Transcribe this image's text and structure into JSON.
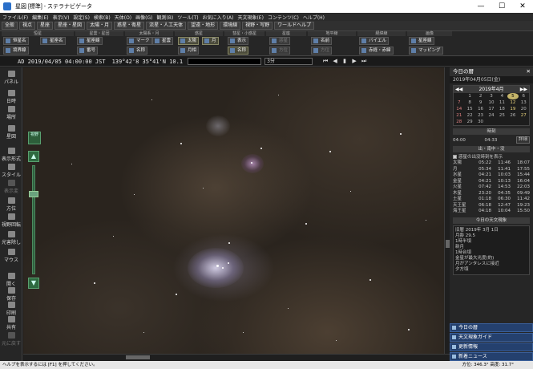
{
  "window": {
    "title": "星図 [標準] - ステラナビゲータ",
    "minimize": "—",
    "maximize": "☐",
    "close": "✕"
  },
  "menu": [
    "ファイル(F)",
    "編集(E)",
    "表示(V)",
    "設定(S)",
    "検索(B)",
    "天体(O)",
    "画像(G)",
    "観測(B)",
    "ツール(T)",
    "お気に入り(A)",
    "天文現象(E)",
    "コンテンツ(C)",
    "ヘルプ(H)"
  ],
  "toolbar": [
    "全般",
    "視点",
    "星座",
    "星座・星図",
    "太陽・月",
    "惑星・衛星",
    "流星・人工天体",
    "望遠・地形",
    "環境線",
    "視野・写野",
    "ワールドヘルプ"
  ],
  "ribbon": {
    "groups": [
      "恒星",
      "星雲・星団",
      "太陽系・月",
      "惑星",
      "彗星・小惑星",
      "星座",
      "地平線",
      "経緯線",
      "画像"
    ],
    "buttons": [
      "恒星名",
      "星座名",
      "星座線",
      "マーク",
      "星雲",
      "太陽",
      "月",
      "表示",
      "惑星",
      "名前",
      "バイエル",
      "星座線",
      "境界線",
      "番号",
      "名称",
      "月相",
      "名称",
      "方位",
      "方位",
      "赤道・経緯",
      "赤経・赤緯",
      "投影",
      "マッピング"
    ]
  },
  "infobar": {
    "datetime": "AD 2019/04/05 04:00:00 JST",
    "coords": "139°42'8  35°41'N  10.1",
    "combo": "3分"
  },
  "left_sidebar": [
    "パネル",
    "日時",
    "場所",
    "星図",
    "表示形式",
    "スタイル",
    "表示変",
    "方位",
    "視野回転",
    "光害除し",
    "マウス",
    "開く",
    "保存",
    "印刷",
    "共有",
    "元に戻す"
  ],
  "sky": {
    "fov_label": "視野"
  },
  "right_panel": {
    "header": "今日の暦",
    "date": "2019年04月05日(金)",
    "calendar": {
      "month": "2019年4月",
      "days": [
        "",
        "1",
        "2",
        "3",
        "4",
        "5",
        "6",
        "7",
        "8",
        "9",
        "10",
        "11",
        "12",
        "13",
        "14",
        "15",
        "16",
        "17",
        "18",
        "19",
        "20",
        "21",
        "22",
        "23",
        "24",
        "25",
        "26",
        "27",
        "28",
        "29",
        "30",
        "",
        "",
        "",
        ""
      ]
    },
    "time_title": "時刻",
    "time_values": [
      "04:00",
      "04:33"
    ],
    "time_button": "詳細",
    "riseset_title": "出・南中・没",
    "riseset_option": "惑星の出没時刻を表示",
    "riseset": [
      [
        "太陽",
        "05:22",
        "11:46",
        "18:07"
      ],
      [
        "月",
        "05:34",
        "11:41",
        "17:55"
      ],
      [
        "水星",
        "04:21",
        "10:03",
        "15:44"
      ],
      [
        "金星",
        "04:21",
        "10:13",
        "16:04"
      ],
      [
        "火星",
        "07:42",
        "14:53",
        "22:03"
      ],
      [
        "木星",
        "23:20",
        "04:35",
        "09:49"
      ],
      [
        "土星",
        "01:18",
        "06:30",
        "11:42"
      ],
      [
        "天王星",
        "06:18",
        "12:47",
        "19:23"
      ],
      [
        "海王星",
        "04:18",
        "10:04",
        "15:50"
      ]
    ],
    "events_title": "今日の天文現象",
    "events": [
      "旧暦 2019年 3月 1日",
      "月齢 29.5",
      "1時半頃",
      "新月",
      "1時台頃",
      "金星が最大光度(約)",
      "月がアンタレスに接近",
      "夕方頃"
    ],
    "links": [
      "今日の暦",
      "天文現象ガイド",
      "更新情報",
      "新着ニュース"
    ]
  },
  "statusbar": {
    "left": "ヘルプを表示するには [F1] を押してください。",
    "right": "方位: 346.3°  高度: 31.7°"
  }
}
